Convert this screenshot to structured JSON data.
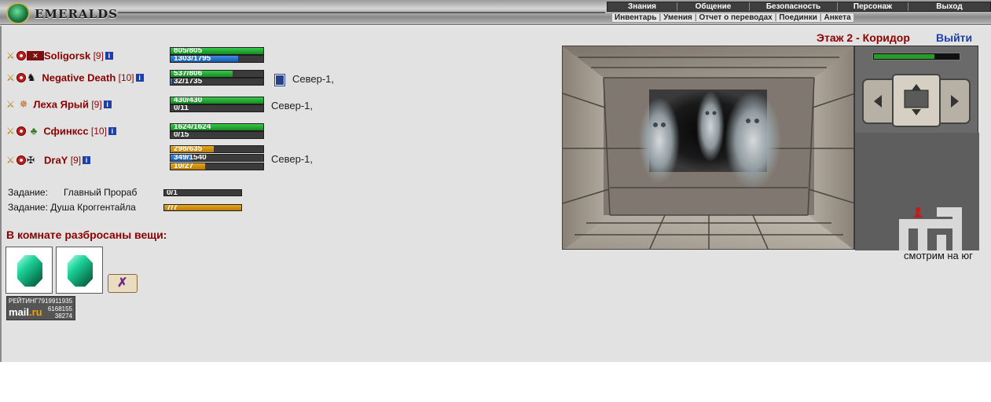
{
  "header": {
    "brand": "EMERALDS",
    "menu_top": [
      "Знания",
      "Общение",
      "Безопасность",
      "Персонаж",
      "Выход"
    ],
    "menu_sub": [
      "Инвентарь",
      "Умения",
      "Отчет о переводах",
      "Поединки",
      "Анкета"
    ]
  },
  "location": {
    "floor": "Этаж 2 - Коридор",
    "exit": "Выйти",
    "facing": "смотрим на юг"
  },
  "players": [
    {
      "name": "Soligorsk",
      "level": "[9]",
      "clan": "✕",
      "location": "",
      "bars": [
        {
          "text": "805/805",
          "type": "hp",
          "value": 1.0
        },
        {
          "text": "1303/1795",
          "type": "mp",
          "value": 0.726
        }
      ]
    },
    {
      "name": "Negative Death",
      "level": "[10]",
      "clan": "",
      "location": "Север-1,",
      "bars": [
        {
          "text": "537/806",
          "type": "hp",
          "value": 0.666
        },
        {
          "text": "32/1735",
          "type": "mp",
          "value": 0.018
        }
      ]
    },
    {
      "name": "Леха Ярый",
      "level": "[9]",
      "clan": "",
      "location": "Север-1,",
      "bars": [
        {
          "text": "430/430",
          "type": "hp",
          "value": 1.0
        },
        {
          "text": "0/11",
          "type": "mp",
          "value": 0.0
        }
      ]
    },
    {
      "name": "Сфинксс",
      "level": "[10]",
      "clan": "",
      "location": "",
      "bars": [
        {
          "text": "1624/1624",
          "type": "hp",
          "value": 1.0
        },
        {
          "text": "0/15",
          "type": "mp",
          "value": 0.0
        }
      ]
    },
    {
      "name": "DraY",
      "level": "[9]",
      "clan": "",
      "location": "Север-1,",
      "bars": [
        {
          "text": "298/635",
          "type": "gold",
          "value": 0.469
        },
        {
          "text": "349/1540",
          "type": "mp",
          "value": 0.227
        },
        {
          "text": "10/27",
          "type": "gold",
          "value": 0.37
        }
      ]
    }
  ],
  "tasks": [
    {
      "label": "Задание:",
      "name": "Главный Прораб",
      "progress": "0/1",
      "value": 0.0
    },
    {
      "label": "Задание:",
      "name": "Душа Кроггентайла",
      "progress": "7/7",
      "value": 1.0
    }
  ],
  "items_title": "В комнате разбросаны вещи:",
  "items": [
    {
      "icon": "emerald-icon"
    },
    {
      "icon": "emerald-icon"
    },
    {
      "icon": "scroll-icon"
    }
  ],
  "counter": {
    "top": "РЕЙТИНГ7919911935",
    "brand_a": "mail",
    "brand_b": ".ru",
    "n1": "6168155",
    "n2": "38274"
  },
  "colors": {
    "accent": "#8b0000",
    "link": "#1c3fa8",
    "hp": "#1f9a2c",
    "mp": "#2a6cc4",
    "gold": "#cf8f10"
  }
}
